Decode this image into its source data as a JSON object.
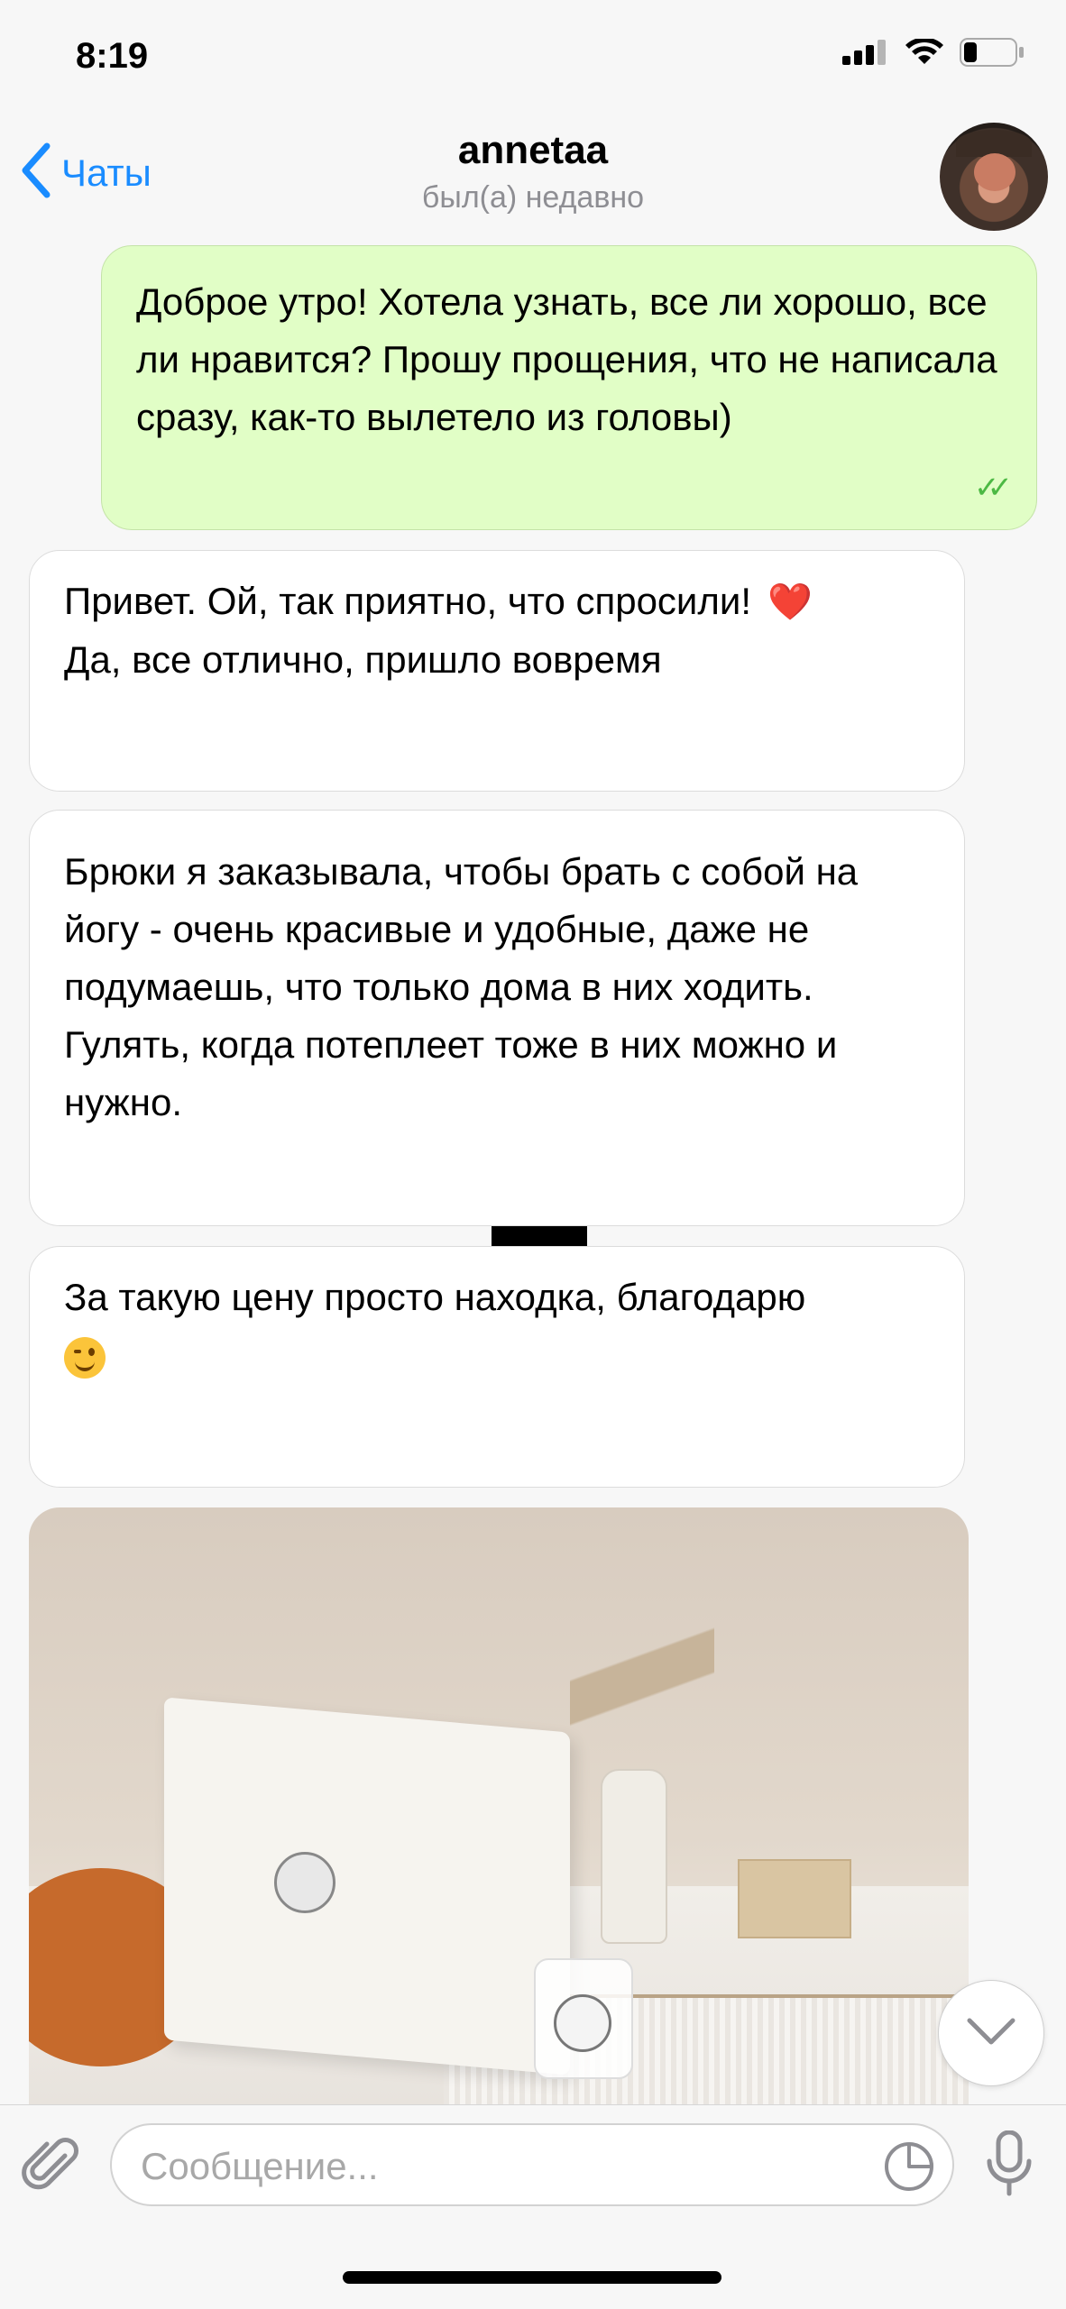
{
  "status": {
    "time": "8:19",
    "icons": [
      "signal-icon",
      "wifi-icon",
      "battery-icon"
    ]
  },
  "header": {
    "back_label": "Чаты",
    "title": "annetaa",
    "subtitle": "был(а) недавно"
  },
  "messages": [
    {
      "direction": "outgoing",
      "text": "Доброе утро! Хотела узнать, все ли хорошо, все ли нравится? Прошу прощения, что не написала сразу, как-то вылетело из головы)",
      "status": "read"
    },
    {
      "direction": "incoming",
      "text_line1": "Привет. Ой, так приятно, что спросили!",
      "emoji1": "❤️",
      "text_line2": " Да, все отлично, пришло вовремя"
    },
    {
      "direction": "incoming",
      "text": "Брюки я заказывала, чтобы брать с собой на йогу - очень красивые и удобные, даже не подумаешь, что только дома в них ходить. Гулять, когда потеплеет тоже в них можно и нужно."
    },
    {
      "direction": "incoming",
      "text": "За такую цену просто находка, благодарю",
      "emoji": "wink-emoji"
    },
    {
      "direction": "incoming",
      "type": "photo"
    }
  ],
  "input": {
    "placeholder": "Сообщение...",
    "value": ""
  },
  "colors": {
    "accent": "#1a8cff",
    "outgoing_bubble": "#e1fec6",
    "incoming_bubble": "#ffffff",
    "read_checks": "#4cb944"
  }
}
